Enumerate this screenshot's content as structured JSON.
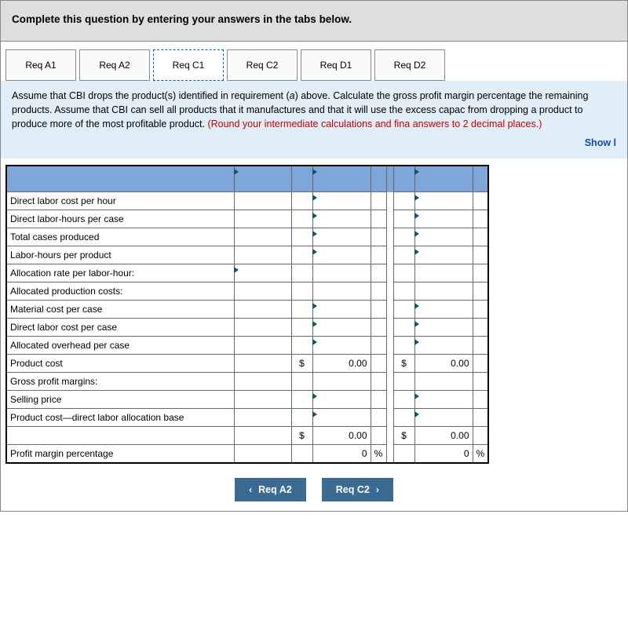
{
  "header": {
    "title": "Complete this question by entering your answers in the tabs below."
  },
  "tabs": {
    "t0": "Req A1",
    "t1": "Req A2",
    "t2": "Req C1",
    "t3": "Req C2",
    "t4": "Req D1",
    "t5": "Req D2"
  },
  "instr": {
    "p1": "Assume that CBI drops the product(s) identified in requirement (",
    "p1i": "a",
    "p2": ") above. Calculate the gross profit margin percentage the remaining products. Assume that CBI can sell all products that it manufactures and that it will use the excess capac from dropping a product to produce more of the most profitable product. ",
    "red": "(Round your intermediate calculations and fina answers to 2 decimal places.)",
    "show": "Show l"
  },
  "rows": {
    "r0": "Direct labor cost per hour",
    "r1": "Direct labor-hours per case",
    "r2": "Total cases produced",
    "r3": "Labor-hours per product",
    "r4": "Allocation rate per labor-hour:",
    "r5": "Allocated production costs:",
    "r6": "Material cost per case",
    "r7": "Direct labor cost per case",
    "r8": "Allocated overhead per case",
    "r9": "Product cost",
    "r10": "Gross profit margins:",
    "r11": "Selling price",
    "r12": "Product cost—direct labor allocation base",
    "r13": "",
    "r14": "Profit margin percentage"
  },
  "sym": {
    "dollar": "$",
    "pct": "%"
  },
  "vals": {
    "zero2": "0.00",
    "zero": "0"
  },
  "nav": {
    "prev": "Req A2",
    "next": "Req C2"
  }
}
